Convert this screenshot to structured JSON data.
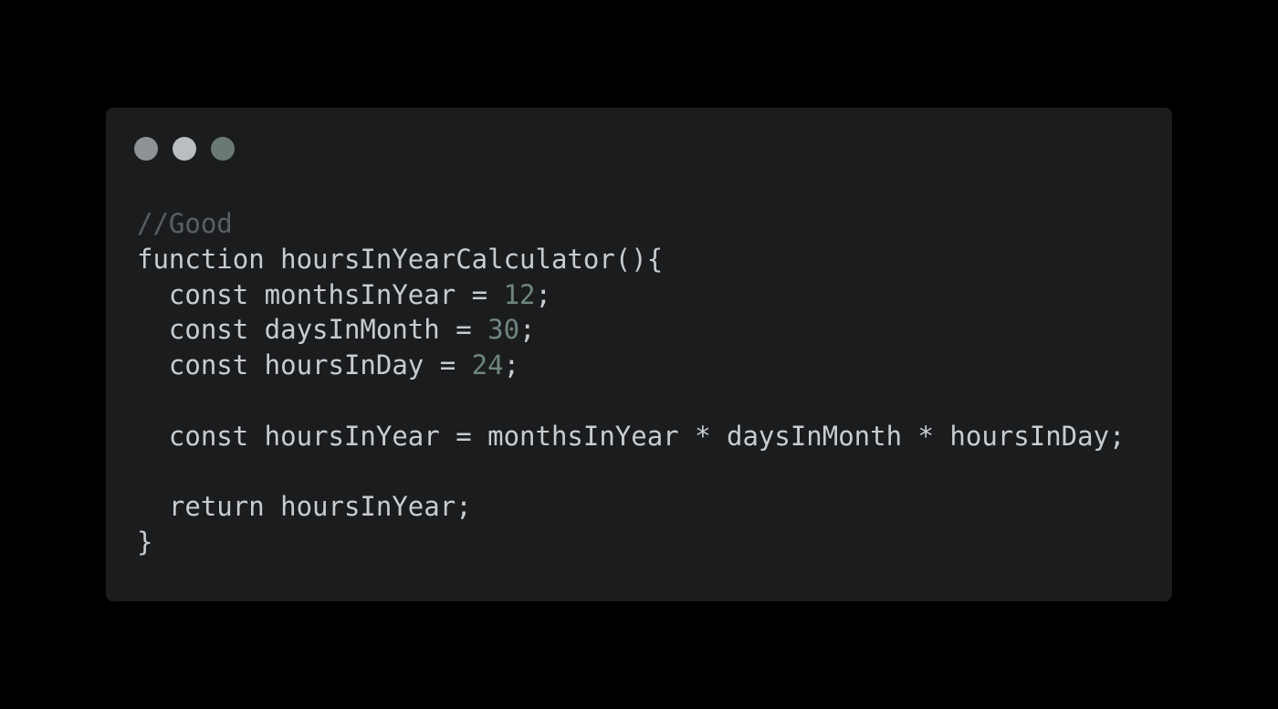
{
  "window": {
    "background": "#1b1c1e",
    "controls": [
      {
        "name": "window-dot-1",
        "color": "#8f9294"
      },
      {
        "name": "window-dot-2",
        "color": "#b9bec2"
      },
      {
        "name": "window-dot-3",
        "color": "#6a7876"
      }
    ]
  },
  "code": {
    "language": "javascript",
    "lines": [
      [
        {
          "t": "//Good",
          "k": "comment"
        }
      ],
      [
        {
          "t": "function hoursInYearCalculator(){",
          "k": "plain"
        }
      ],
      [
        {
          "t": "  const monthsInYear = ",
          "k": "plain"
        },
        {
          "t": "12",
          "k": "number"
        },
        {
          "t": ";",
          "k": "plain"
        }
      ],
      [
        {
          "t": "  const daysInMonth = ",
          "k": "plain"
        },
        {
          "t": "30",
          "k": "number"
        },
        {
          "t": ";",
          "k": "plain"
        }
      ],
      [
        {
          "t": "  const hoursInDay = ",
          "k": "plain"
        },
        {
          "t": "24",
          "k": "number"
        },
        {
          "t": ";",
          "k": "plain"
        }
      ],
      [],
      [
        {
          "t": "  const hoursInYear = monthsInYear * daysInMonth * hoursInDay;",
          "k": "plain"
        }
      ],
      [],
      [
        {
          "t": "  return hoursInYear;",
          "k": "plain"
        }
      ],
      [
        {
          "t": "}",
          "k": "plain"
        }
      ]
    ]
  }
}
